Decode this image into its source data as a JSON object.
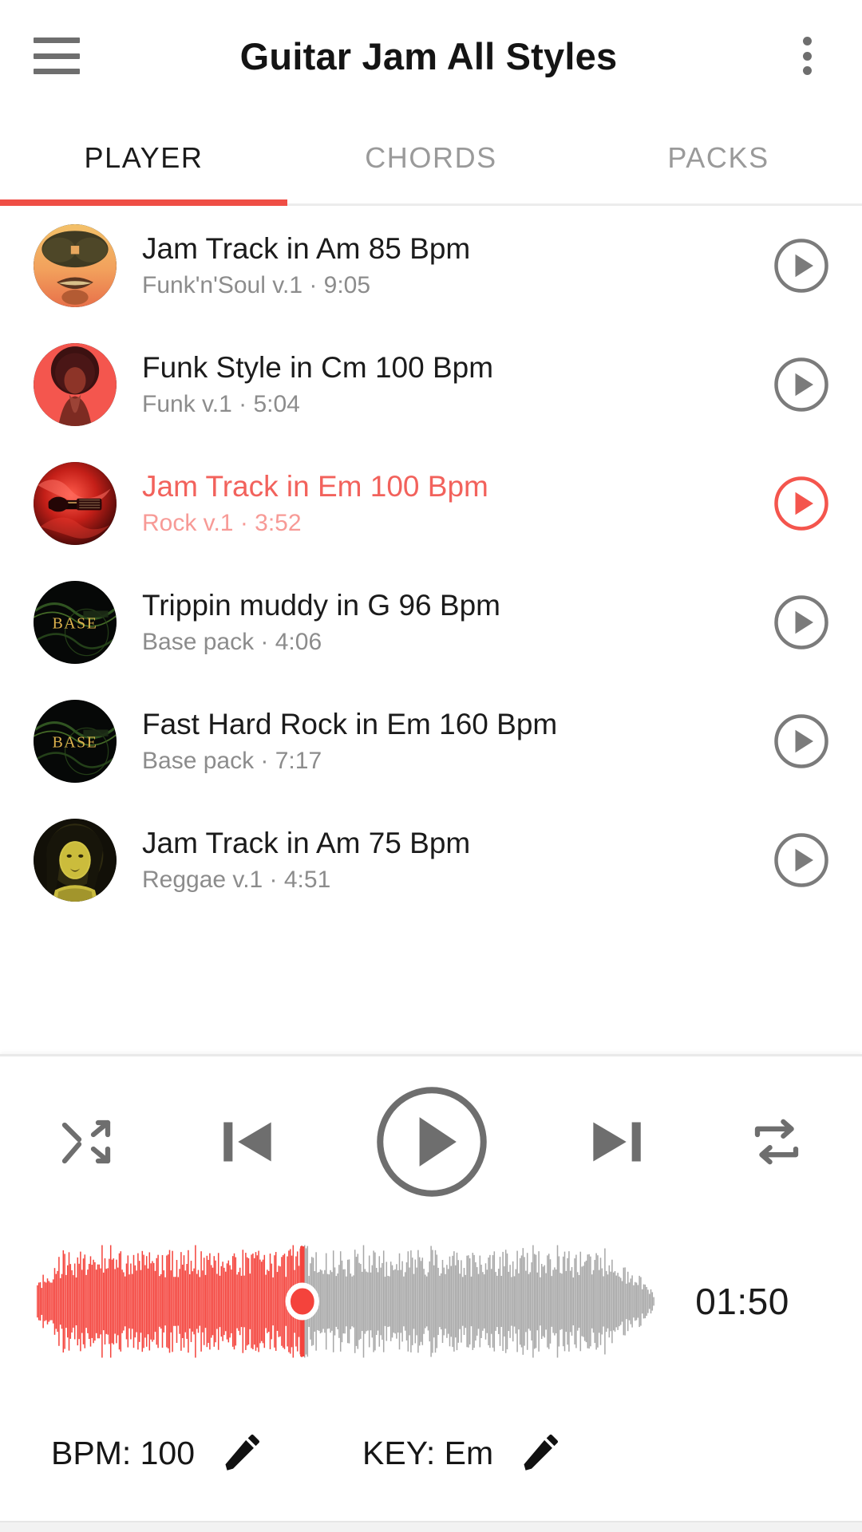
{
  "appbar": {
    "menu_icon": "hamburger-menu-icon",
    "title": "Guitar Jam All Styles",
    "overflow_icon": "more-vertical-icon"
  },
  "tabs": {
    "items": [
      {
        "label": "PLAYER",
        "active": true
      },
      {
        "label": "CHORDS",
        "active": false
      },
      {
        "label": "PACKS",
        "active": false
      }
    ],
    "indicator_color": "#ef4e45"
  },
  "tracks": [
    {
      "title": "Jam Track in Am 85 Bpm",
      "pack": "Funk'n'Soul v.1",
      "separator": "·",
      "duration": "9:05",
      "subtitle": "Funk'n'Soul v.1  ·  9:05",
      "artwork": "funk-soul-sunglasses-face",
      "playing": false,
      "play_icon": "play-circle-icon"
    },
    {
      "title": "Funk Style in Cm 100 Bpm",
      "pack": "Funk v.1",
      "separator": "·",
      "duration": "5:04",
      "subtitle": "Funk v.1  ·  5:04",
      "artwork": "funk-afro-woman",
      "playing": false,
      "play_icon": "play-circle-icon"
    },
    {
      "title": "Jam Track in Em 100 Bpm",
      "pack": "Rock v.1",
      "separator": "·",
      "duration": "3:52",
      "subtitle": "Rock v.1  ·  3:52",
      "artwork": "rock-red-guitar-smoke",
      "playing": true,
      "play_icon": "play-circle-icon"
    },
    {
      "title": "Trippin muddy in G 96 Bpm",
      "pack": "Base pack",
      "separator": "·",
      "duration": "4:06",
      "subtitle": "Base pack  ·  4:06",
      "artwork": "base-pack-dark",
      "playing": false,
      "play_icon": "play-circle-icon"
    },
    {
      "title": "Fast Hard Rock in Em 160 Bpm",
      "pack": "Base pack",
      "separator": "·",
      "duration": "7:17",
      "subtitle": "Base pack  ·  7:17",
      "artwork": "base-pack-dark",
      "playing": false,
      "play_icon": "play-circle-icon"
    },
    {
      "title": "Jam Track in Am 75 Bpm",
      "pack": "Reggae v.1",
      "separator": "·",
      "duration": "4:51",
      "subtitle": "Reggae v.1  ·  4:51",
      "artwork": "reggae-dreadlocks-portrait",
      "playing": false,
      "play_icon": "play-circle-icon"
    }
  ],
  "player": {
    "shuffle_icon": "shuffle-icon",
    "previous_icon": "skip-previous-icon",
    "play_icon": "play-circle-large-icon",
    "next_icon": "skip-next-icon",
    "repeat_icon": "repeat-icon",
    "elapsed_time": "01:50",
    "progress_percent": 43,
    "played_color": "#f4433c",
    "remaining_color": "#a8a8a8",
    "playhead_color": "#f4433c"
  },
  "meta": {
    "bpm_label": "BPM: 100",
    "bpm_edit_icon": "pencil-icon",
    "key_label": "KEY: Em",
    "key_edit_icon": "pencil-icon"
  },
  "theme": {
    "accent": "#ef4e45",
    "active_track": "#f2625c",
    "text_primary": "#1b1b1b",
    "text_secondary": "#8c8c8c"
  }
}
